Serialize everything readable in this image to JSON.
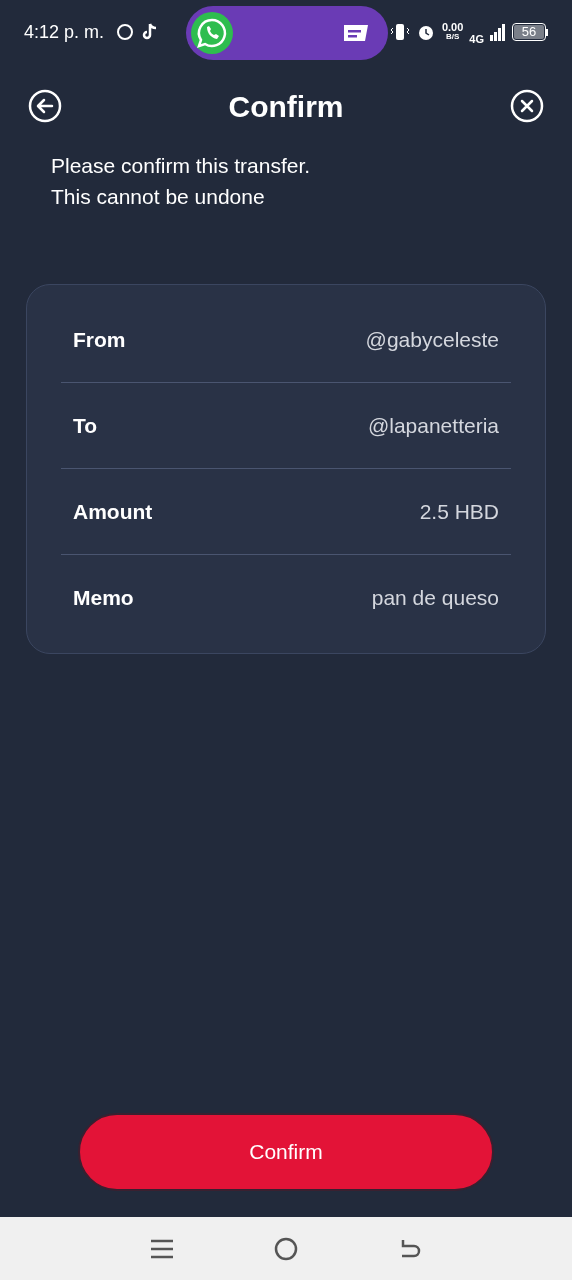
{
  "status_bar": {
    "time": "4:12 p. m.",
    "speed_value": "0.00",
    "speed_unit": "B/S",
    "network": "4G",
    "battery": "56"
  },
  "header": {
    "title": "Confirm"
  },
  "message": [
    "Please confirm this transfer.",
    "This cannot be undone"
  ],
  "details": [
    {
      "label": "From",
      "value": "@gabyceleste"
    },
    {
      "label": "To",
      "value": "@lapanetteria"
    },
    {
      "label": "Amount",
      "value": "2.5 HBD"
    },
    {
      "label": "Memo",
      "value": "pan de queso"
    }
  ],
  "confirm_button": "Confirm"
}
